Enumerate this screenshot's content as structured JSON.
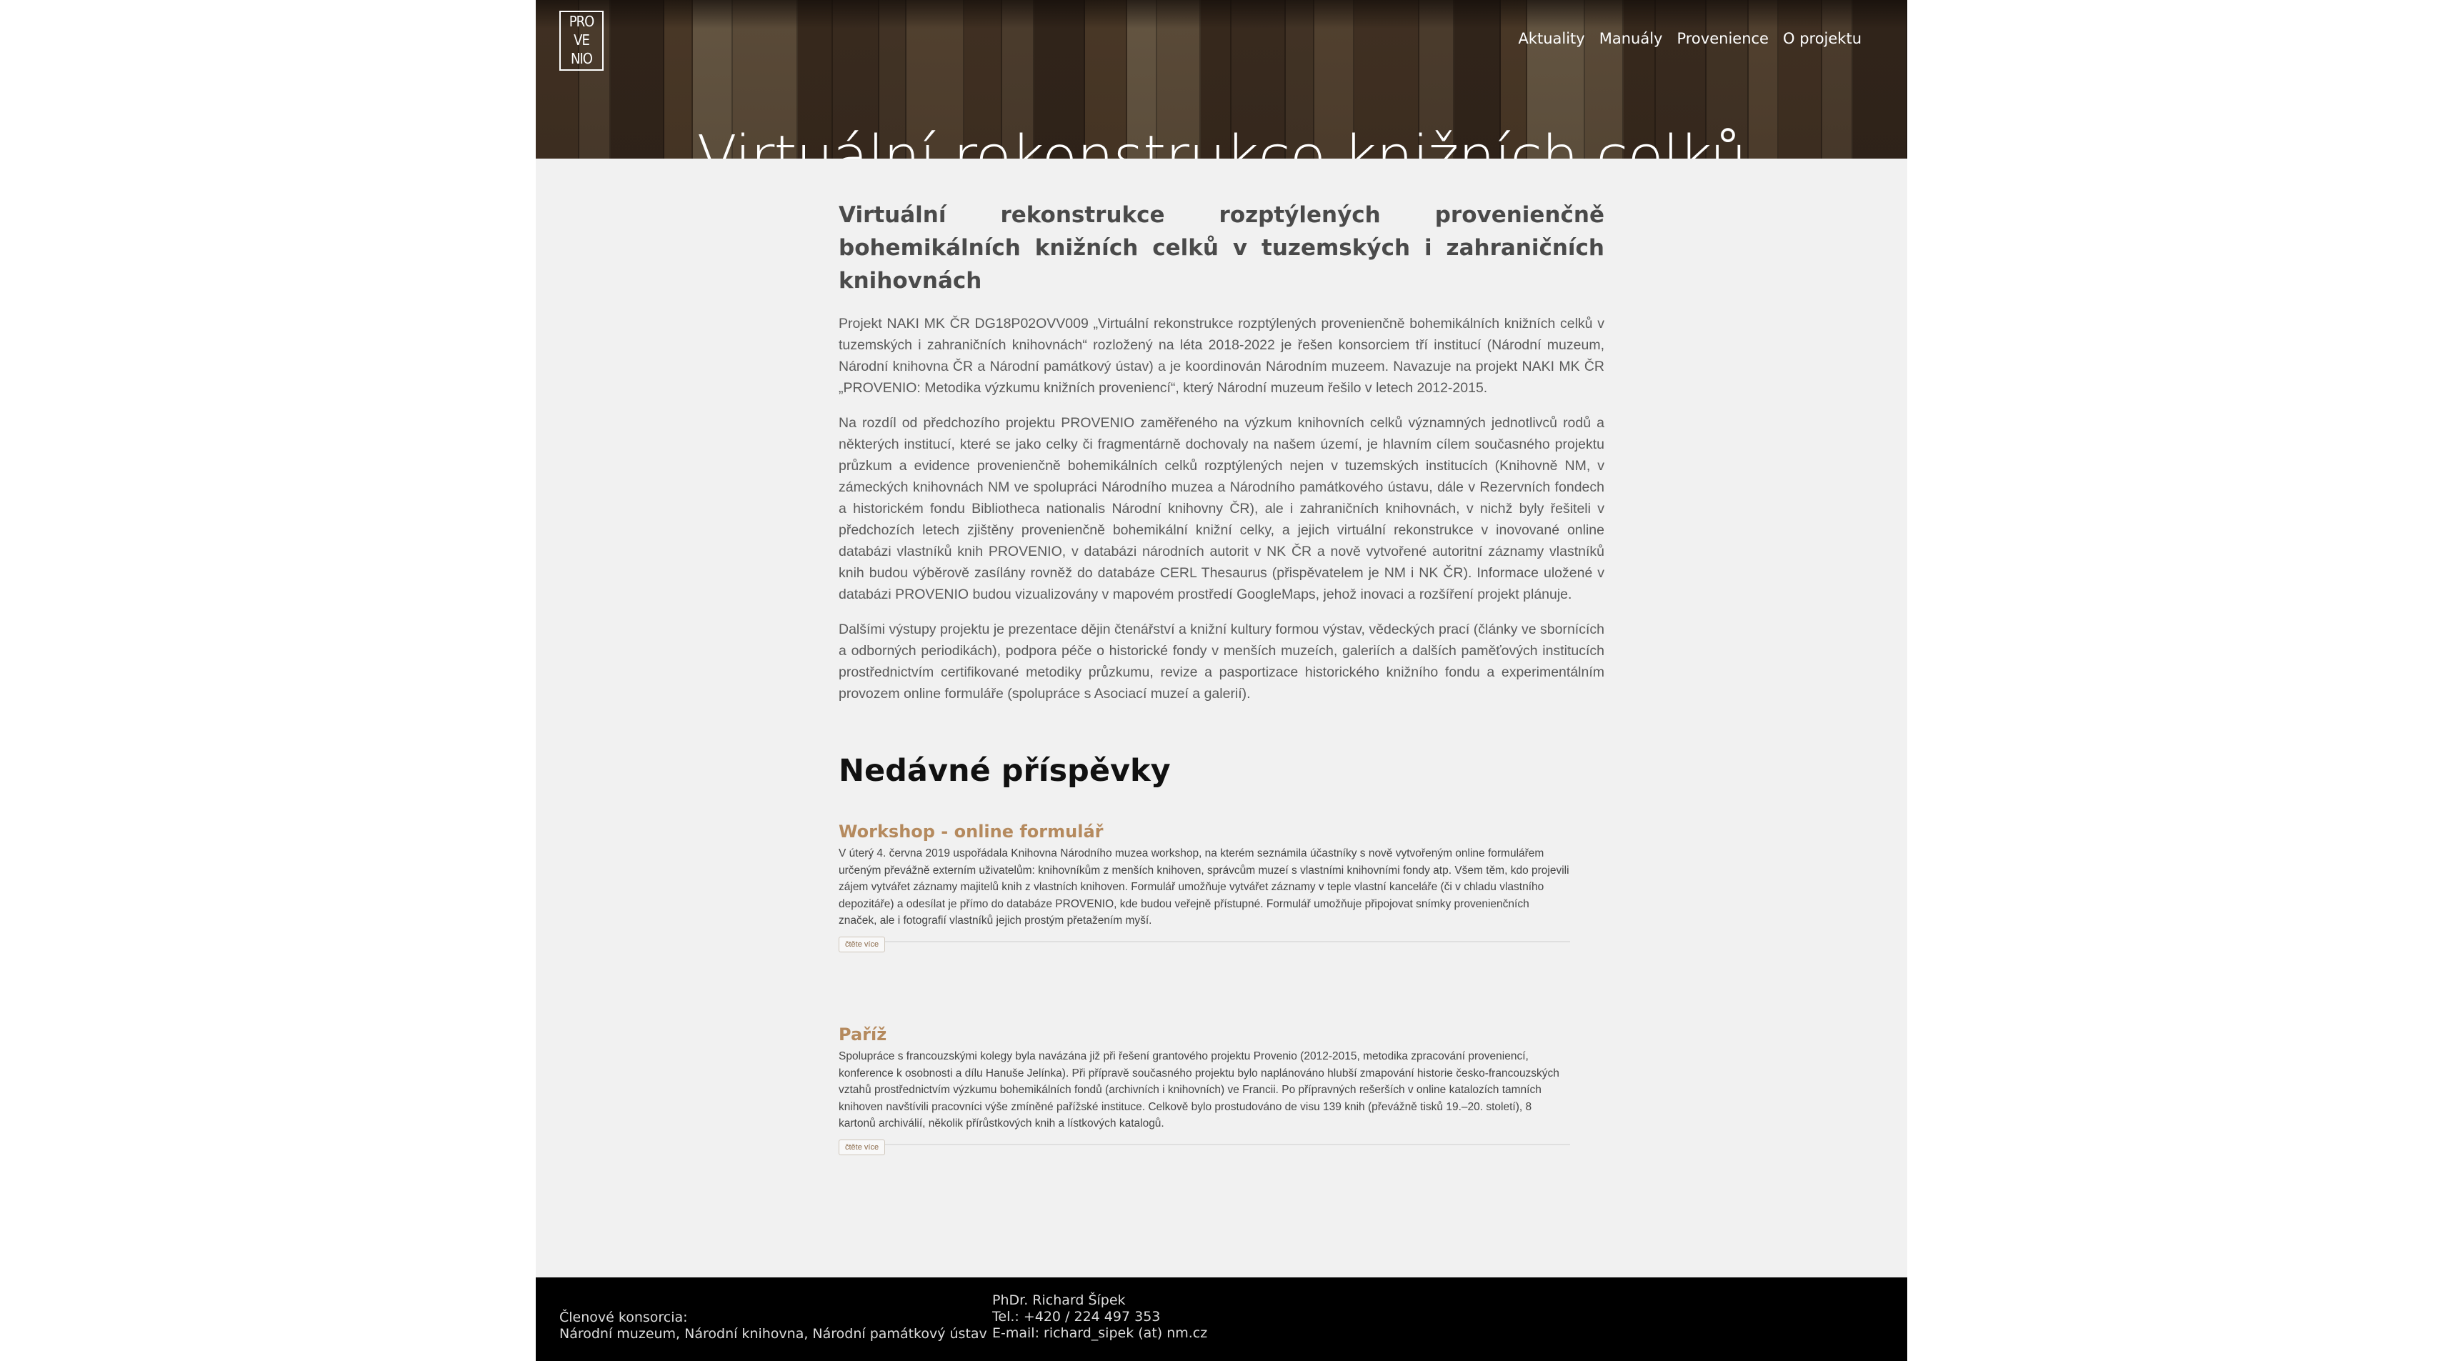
{
  "logo": {
    "line1": "PRO",
    "line2": "VE",
    "line3": "NIO"
  },
  "nav": [
    "Aktuality",
    "Manuály",
    "Provenience",
    "O projektu"
  ],
  "hero": {
    "title": "Virtuální rekonstrukce knižních celků"
  },
  "intro": {
    "heading": "Virtuální rekonstrukce rozptýlených provenienčně bohemikálních knižních celků v tuzemských i zahraničních knihovnách",
    "paragraphs": [
      "Projekt NAKI MK ČR DG18P02OVV009 „Virtuální rekonstrukce rozptýlených provenienčně bohemikálních knižních celků v tuzemských i zahraničních knihovnách“ rozložený na léta 2018-2022 je řešen konsorciem tří institucí (Národní muzeum, Národní knihovna ČR a Národní památkový ústav) a je koordinován Národním muzeem. Navazuje na projekt NAKI MK ČR „PROVENIO: Metodika výzkumu knižních proveniencí“, který Národní muzeum řešilo v letech 2012-2015.",
      "Na rozdíl od předchozího projektu PROVENIO zaměřeného na výzkum knihovních celků významných jednotlivců rodů a některých institucí, které se jako celky či fragmentárně dochovaly na našem území, je hlavním cílem současného projektu průzkum a evidence provenienčně bohemikálních celků rozptýlených nejen v tuzemských institucích (Knihovně NM, v zámeckých knihovnách NM ve spolupráci Národního muzea a Národního památkového ústavu, dále v Rezervních fondech a historickém fondu Bibliotheca nationalis Národní knihovny ČR), ale i zahraničních knihovnách, v nichž byly řešiteli v předchozích letech zjištěny provenienčně bohemikální knižní celky, a jejich virtuální rekonstrukce v inovované online databázi vlastníků knih PROVENIO, v databázi národních autorit v NK ČR a nově vytvořené autoritní záznamy vlastníků knih budou výběrově zasílány rovněž do databáze CERL Thesaurus (přispěvatelem je NM i NK ČR). Informace uložené v databázi PROVENIO budou vizualizovány v mapovém prostředí GoogleMaps, jehož inovaci a rozšíření projekt plánuje.",
      "Dalšími výstupy projektu je prezentace dějin čtenářství a knižní kultury formou výstav, vědeckých prací (články ve sbornících a odborných periodikách), podpora péče o historické fondy v menších muzeích, galeriích a dalších paměťových institucích prostřednictvím certifikované metodiky průzkumu, revize a pasportizace historického knižního fondu a experimentálním provozem online formuláře (spolupráce s Asociací muzeí a galerií)."
    ]
  },
  "recent": {
    "heading": "Nedávné příspěvky",
    "posts": [
      {
        "title": "Workshop - online formulář",
        "excerpt": "V úterý 4. června 2019 uspořádala Knihovna Národního muzea workshop, na kterém seznámila účastníky s nově vytvořeným online formulářem určeným převážně externím uživatelům: knihovníkům z menších knihoven, správcům muzeí s vlastními knihovními fondy atp. Všem těm, kdo projevili zájem vytvářet záznamy majitelů knih z vlastních knihoven. Formulář umožňuje vytvářet záznamy v teple vlastní kanceláře (či v chladu vlastního depozitáře) a odesílat je přímo do databáze PROVENIO, kde budou veřejně přístupné. Formulář umožňuje připojovat snímky provenienčních značek, ale i fotografií vlastníků jejich prostým přetažením myší.",
        "readmore": "čtěte více"
      },
      {
        "title": "Paříž",
        "excerpt": "Spolupráce s francouzskými kolegy byla navázána již při řešení grantového projektu Provenio (2012-2015, metodika zpracování proveniencí, konference k osobnosti a dílu Hanuše Jelínka). Při přípravě současného projektu bylo naplánováno hlubší zmapování historie česko-francouzských vztahů prostřednictvím výzkumu bohemikálních fondů (archivních i knihovních) ve Francii. Po přípravných rešerších v online katalozích tamních knihoven navštívili pracovníci výše zmíněné pařížské instituce. Celkově bylo prostudováno de visu 139 knih (převážně tisků 19.–20. století), 8 kartonů archiválií, několik přírůstkových knih a lístkových katalogů.",
        "readmore": "čtěte více"
      }
    ]
  },
  "footer": {
    "members_label": "Členové konsorcia:",
    "members": "Národní muzeum, Národní knihovna, Národní památkový ústav",
    "contact_name": "PhDr. Richard Šípek",
    "contact_phone": "Tel.: +420 / 224 497 353",
    "contact_email": "E-mail: richard_sipek (at) nm.cz"
  },
  "colors": {
    "page_bg": "#f1f1f1",
    "post_title": "#b58a5e",
    "footer_bg": "#000000",
    "hero_bg": "#3a2a1e"
  }
}
